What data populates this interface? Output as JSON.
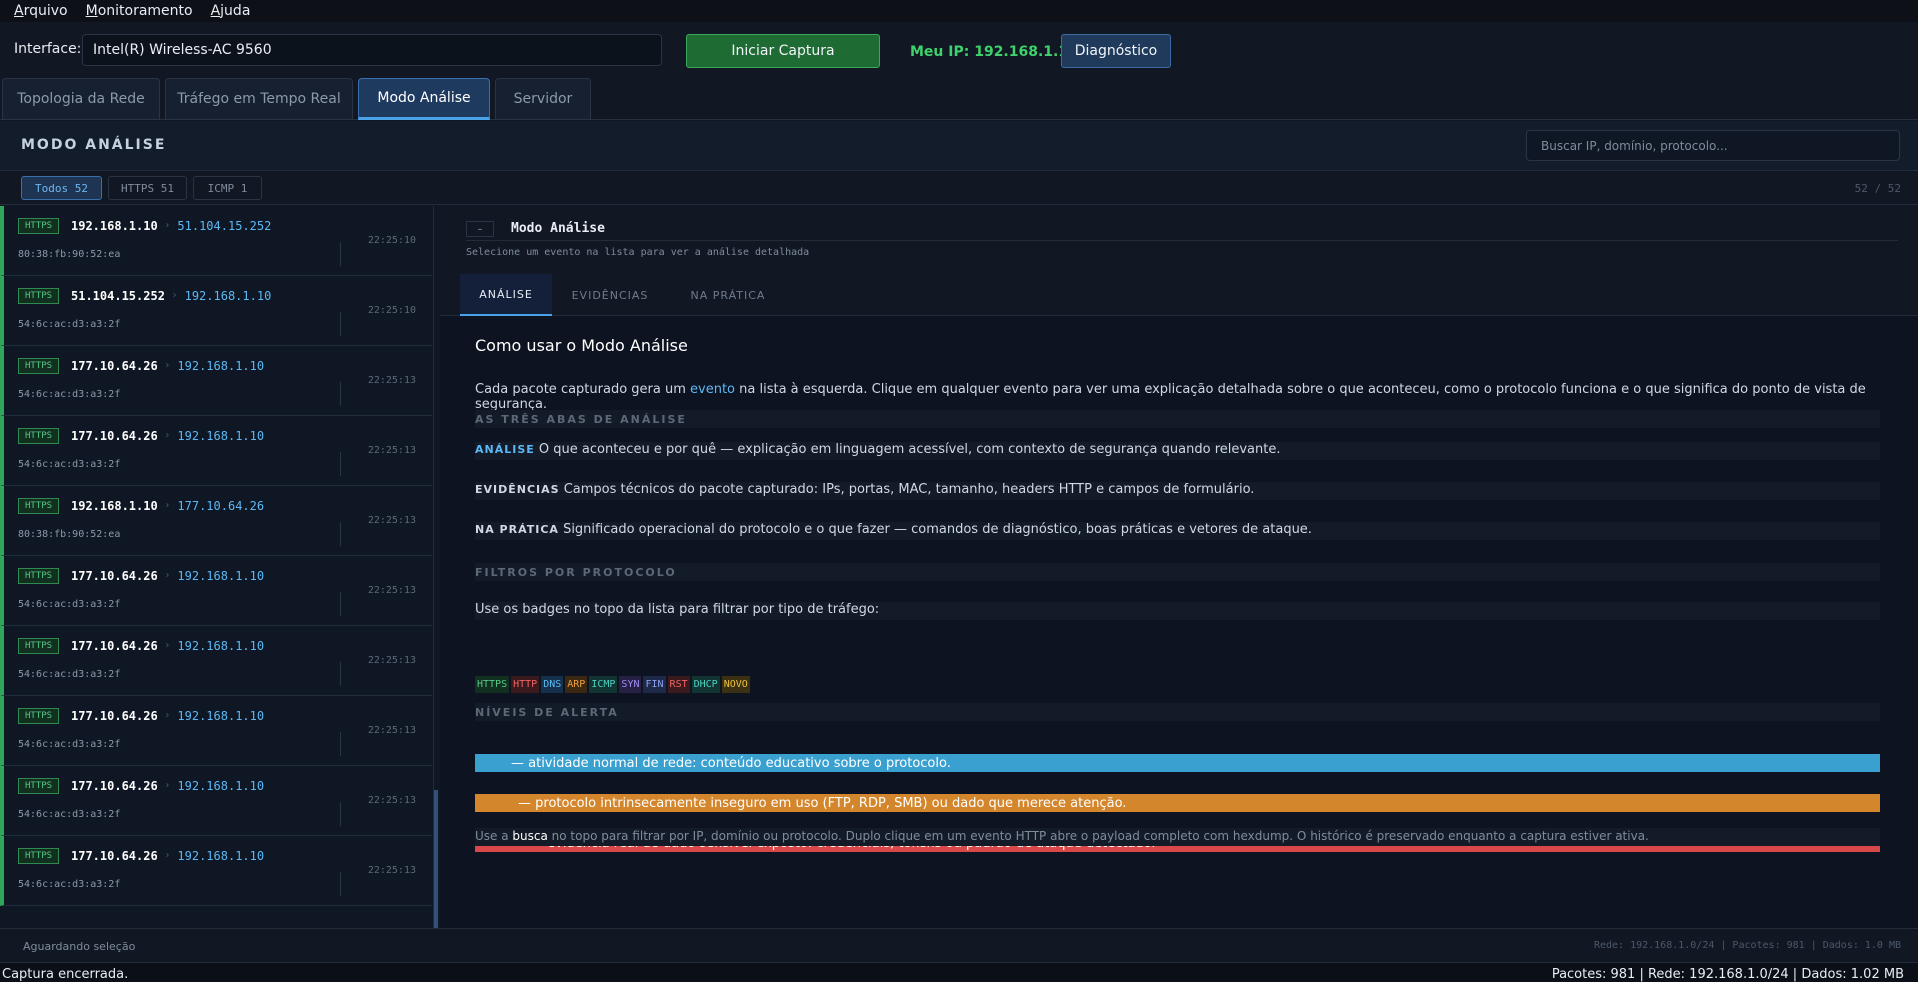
{
  "menu": [
    "Arquivo",
    "Monitoramento",
    "Ajuda"
  ],
  "toolbar": {
    "interface_label": "Interface:",
    "interface_value": "Intel(R) Wireless-AC 9560",
    "start_label": "Iniciar Captura",
    "myip_label": "Meu IP: 192.168.1.10",
    "diag_label": "Diagnóstico"
  },
  "tabs": [
    "Topologia da Rede",
    "Tráfego em Tempo Real",
    "Modo Análise",
    "Servidor"
  ],
  "active_tab": "Modo Análise",
  "panel": {
    "title": "MODO ANÁLISE",
    "search_placeholder": "Buscar IP, domínio, protocolo...",
    "filters": [
      "Todos 52",
      "HTTPS 51",
      "ICMP 1"
    ],
    "count": "52 / 52"
  },
  "events": [
    {
      "proto": "HTTPS",
      "src": "192.168.1.10",
      "dst": "51.104.15.252",
      "mac": "80:38:fb:90:52:ea",
      "time": "22:25:10"
    },
    {
      "proto": "HTTPS",
      "src": "51.104.15.252",
      "dst": "192.168.1.10",
      "mac": "54:6c:ac:d3:a3:2f",
      "time": "22:25:10"
    },
    {
      "proto": "HTTPS",
      "src": "177.10.64.26",
      "dst": "192.168.1.10",
      "mac": "54:6c:ac:d3:a3:2f",
      "time": "22:25:13"
    },
    {
      "proto": "HTTPS",
      "src": "177.10.64.26",
      "dst": "192.168.1.10",
      "mac": "54:6c:ac:d3:a3:2f",
      "time": "22:25:13"
    },
    {
      "proto": "HTTPS",
      "src": "192.168.1.10",
      "dst": "177.10.64.26",
      "mac": "80:38:fb:90:52:ea",
      "time": "22:25:13"
    },
    {
      "proto": "HTTPS",
      "src": "177.10.64.26",
      "dst": "192.168.1.10",
      "mac": "54:6c:ac:d3:a3:2f",
      "time": "22:25:13"
    },
    {
      "proto": "HTTPS",
      "src": "177.10.64.26",
      "dst": "192.168.1.10",
      "mac": "54:6c:ac:d3:a3:2f",
      "time": "22:25:13"
    },
    {
      "proto": "HTTPS",
      "src": "177.10.64.26",
      "dst": "192.168.1.10",
      "mac": "54:6c:ac:d3:a3:2f",
      "time": "22:25:13"
    },
    {
      "proto": "HTTPS",
      "src": "177.10.64.26",
      "dst": "192.168.1.10",
      "mac": "54:6c:ac:d3:a3:2f",
      "time": "22:25:13"
    },
    {
      "proto": "HTTPS",
      "src": "177.10.64.26",
      "dst": "192.168.1.10",
      "mac": "54:6c:ac:d3:a3:2f",
      "time": "22:25:13"
    }
  ],
  "detail": {
    "collapse_label": "–",
    "title": "Modo Análise",
    "subtitle": "Selecione um evento na lista para ver a análise detalhada",
    "tabs": [
      "ANÁLISE",
      "EVIDÊNCIAS",
      "NA PRÁTICA"
    ],
    "heading": "Como usar o Modo Análise",
    "intro_a": "Cada pacote capturado gera um ",
    "intro_link": "evento",
    "intro_b": " na lista à esquerda. Clique em qualquer evento para ver uma explicação detalhada sobre o que aconteceu, como o protocolo funciona e o que significa do ponto de vista de segurança.",
    "sec_tabs": "AS TRÊS ABAS DE ANÁLISE",
    "tab1_key": "ANÁLISE",
    "tab1_text": " O que aconteceu e por quê — explicação em linguagem acessível, com contexto de segurança quando relevante.",
    "tab2_key": "EVIDÊNCIAS",
    "tab2_text": " Campos técnicos do pacote capturado: IPs, portas, MAC, tamanho, headers HTTP e campos de formulário.",
    "tab3_key": "NA PRÁTICA",
    "tab3_text": " Significado operacional do protocolo e o que fazer — comandos de diagnóstico, boas práticas e vetores de ataque.",
    "sec_filters": "FILTROS POR PROTOCOLO",
    "filters_text": "Use os badges no topo da lista para filtrar por tipo de tráfego:",
    "badges": [
      {
        "label": "HTTPS",
        "fg": "#55c987",
        "bg": "#12301f"
      },
      {
        "label": "HTTP",
        "fg": "#f06464",
        "bg": "#3a1a1d"
      },
      {
        "label": "DNS",
        "fg": "#5cb8f5",
        "bg": "#15304a"
      },
      {
        "label": "ARP",
        "fg": "#f0a040",
        "bg": "#3a2812"
      },
      {
        "label": "ICMP",
        "fg": "#4cd0c0",
        "bg": "#123533"
      },
      {
        "label": "SYN",
        "fg": "#a08cf0",
        "bg": "#262045"
      },
      {
        "label": "FIN",
        "fg": "#8ca0f0",
        "bg": "#1e2848"
      },
      {
        "label": "RST",
        "fg": "#f06464",
        "bg": "#3a1a1d"
      },
      {
        "label": "DHCP",
        "fg": "#4cd0c0",
        "bg": "#123533"
      },
      {
        "label": "NOVO",
        "fg": "#f0c040",
        "bg": "#3a3012"
      }
    ],
    "sec_alerts": "NÍVEIS DE ALERTA",
    "alerts": [
      {
        "text": "— atividade normal de rede: conteúdo educativo sobre o protocolo.",
        "color": "#3aa0d0"
      },
      {
        "text": "— protocolo intrinsecamente inseguro em uso (FTP, RDP, SMB) ou dado que merece atenção.",
        "color": "#d4862c"
      },
      {
        "text": "— evidência real de dado sensível exposto: credenciais, tokens ou padrão de ataque detectado.",
        "color": "#d84848"
      }
    ],
    "foot_a": "Use a ",
    "foot_b": "busca",
    "foot_c": " no topo para filtrar por IP, domínio ou protocolo. Duplo clique em um evento HTTP abre o payload completo com hexdump. O histórico é preservado enquanto a captura estiver ativa."
  },
  "status_inner": {
    "awaiting": "Aguardando seleção",
    "stats": "Rede: 192.168.1.0/24  |  Pacotes: 981  |  Dados: 1.0 MB"
  },
  "statusbar": {
    "left": "Captura encerrada.",
    "right": "Pacotes: 981  |  Rede: 192.168.1.0/24  |  Dados: 1.02 MB"
  }
}
